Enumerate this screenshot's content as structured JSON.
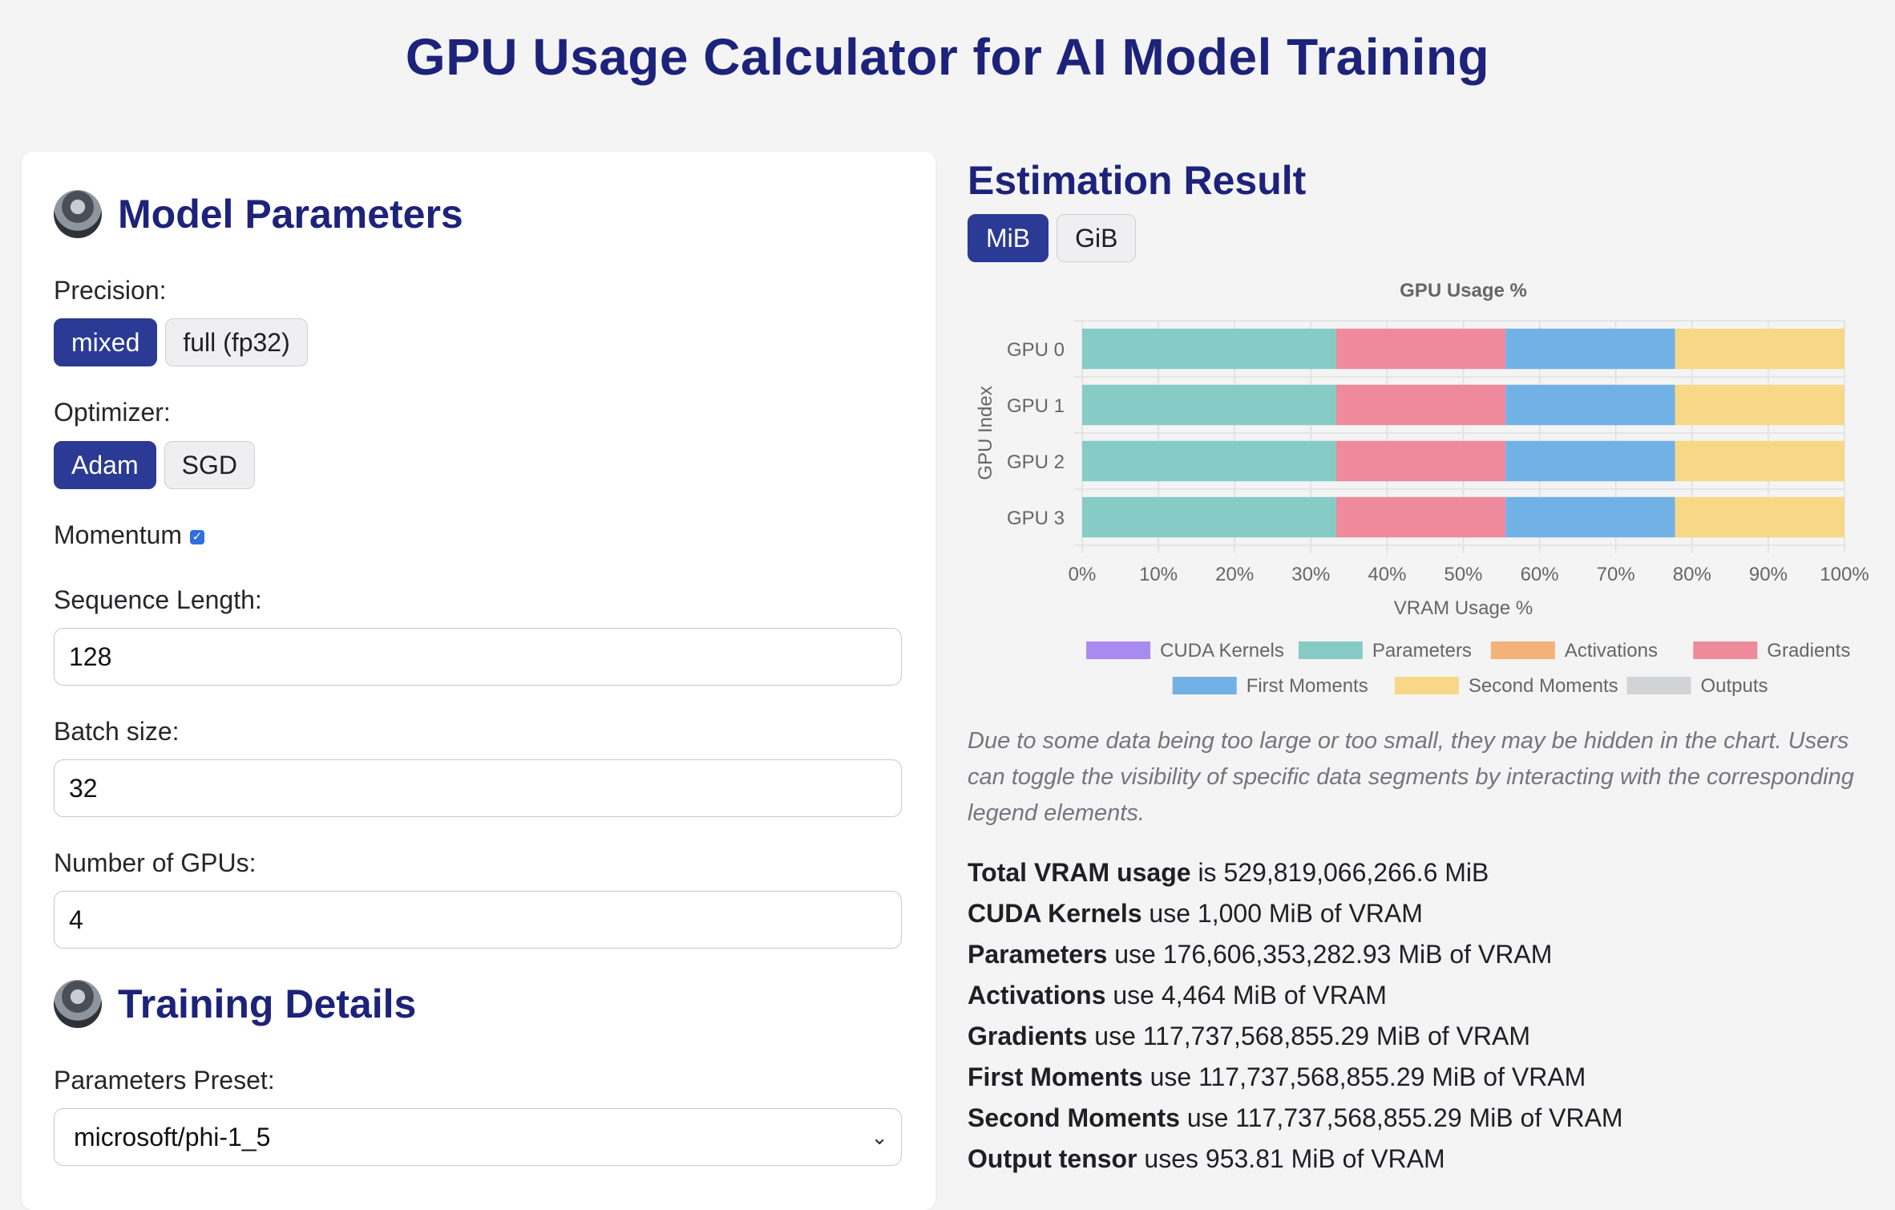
{
  "page_title": "GPU Usage Calculator for AI Model Training",
  "model_params": {
    "title": "Model Parameters",
    "precision": {
      "label": "Precision:",
      "options": [
        "mixed",
        "full (fp32)"
      ],
      "selected": "mixed"
    },
    "optimizer": {
      "label": "Optimizer:",
      "options": [
        "Adam",
        "SGD"
      ],
      "selected": "Adam"
    },
    "momentum": {
      "label": "Momentum",
      "checked": true
    },
    "sequence_length": {
      "label": "Sequence Length:",
      "value": "128"
    },
    "batch_size": {
      "label": "Batch size:",
      "value": "32"
    },
    "num_gpus": {
      "label": "Number of GPUs:",
      "value": "4"
    }
  },
  "training_details": {
    "title": "Training Details",
    "preset": {
      "label": "Parameters Preset:",
      "value": "microsoft/phi-1_5"
    }
  },
  "result": {
    "title": "Estimation Result",
    "units": [
      "MiB",
      "GiB"
    ],
    "selected_unit": "MiB",
    "note": "Due to some data being too large or too small, they may be hidden in the chart. Users can toggle the visibility of specific data segments by interacting with the corresponding legend elements.",
    "summary": [
      {
        "key": "Total VRAM usage",
        "rest": " is 529,819,066,266.6 MiB"
      },
      {
        "key": "CUDA Kernels",
        "rest": " use 1,000 MiB of VRAM"
      },
      {
        "key": "Parameters",
        "rest": " use 176,606,353,282.93 MiB of VRAM"
      },
      {
        "key": "Activations",
        "rest": " use 4,464 MiB of VRAM"
      },
      {
        "key": "Gradients",
        "rest": " use 117,737,568,855.29 MiB of VRAM"
      },
      {
        "key": "First Moments",
        "rest": " use 117,737,568,855.29 MiB of VRAM"
      },
      {
        "key": "Second Moments",
        "rest": " use 117,737,568,855.29 MiB of VRAM"
      },
      {
        "key": "Output tensor",
        "rest": " uses 953.81 MiB of VRAM"
      }
    ]
  },
  "chart_data": {
    "type": "bar",
    "orientation": "horizontal",
    "stacked": true,
    "title": "GPU Usage %",
    "xlabel": "VRAM Usage %",
    "ylabel": "GPU Index",
    "categories": [
      "GPU 0",
      "GPU 1",
      "GPU 2",
      "GPU 3"
    ],
    "xlim": [
      0,
      100
    ],
    "xticks": [
      "0%",
      "10%",
      "20%",
      "30%",
      "40%",
      "50%",
      "60%",
      "70%",
      "80%",
      "90%",
      "100%"
    ],
    "grid": true,
    "legend_position": "bottom",
    "series": [
      {
        "name": "CUDA Kernels",
        "color": "#a98af0",
        "values": [
          0,
          0,
          0,
          0
        ]
      },
      {
        "name": "Parameters",
        "color": "#87cbc7",
        "values": [
          33.33,
          33.33,
          33.33,
          33.33
        ]
      },
      {
        "name": "Activations",
        "color": "#f2b27a",
        "values": [
          0,
          0,
          0,
          0
        ]
      },
      {
        "name": "Gradients",
        "color": "#ef8a9d",
        "values": [
          22.22,
          22.22,
          22.22,
          22.22
        ]
      },
      {
        "name": "First Moments",
        "color": "#72b1e6",
        "values": [
          22.22,
          22.22,
          22.22,
          22.22
        ]
      },
      {
        "name": "Second Moments",
        "color": "#f7d886",
        "values": [
          22.22,
          22.22,
          22.22,
          22.22
        ]
      },
      {
        "name": "Outputs",
        "color": "#d2d3d7",
        "values": [
          0,
          0,
          0,
          0
        ]
      }
    ]
  }
}
